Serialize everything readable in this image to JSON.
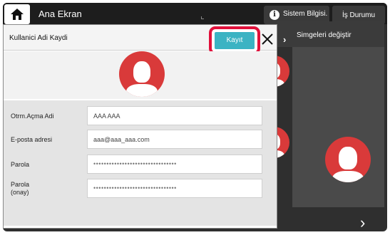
{
  "topbar": {
    "title": "Ana Ekran",
    "home_icon": "home-icon",
    "system_info_label": "Sistem Bilgisi.",
    "system_info_icon": "info-icon",
    "job_status_label": "İş Durumu"
  },
  "side": {
    "change_icons_label": "Simgeleri değiştir"
  },
  "dialog": {
    "title": "Kullanici Adi Kaydi",
    "save_label": "Kayıt",
    "close_icon": "close-icon",
    "highlight_color": "#e0103a",
    "accent_color": "#3bb3c3",
    "avatar_color": "#d93a3a",
    "fields": [
      {
        "label": "Otrm.Açma Adi",
        "value": "AAA AAA"
      },
      {
        "label": "E-posta adresi",
        "value": "aaa@aaa_aaa.com"
      },
      {
        "label": "Parola",
        "value": "••••••••••••••••••••••••••••••••"
      },
      {
        "label": "Parola\n(onay)",
        "value": "••••••••••••••••••••••••••••••••"
      }
    ]
  }
}
